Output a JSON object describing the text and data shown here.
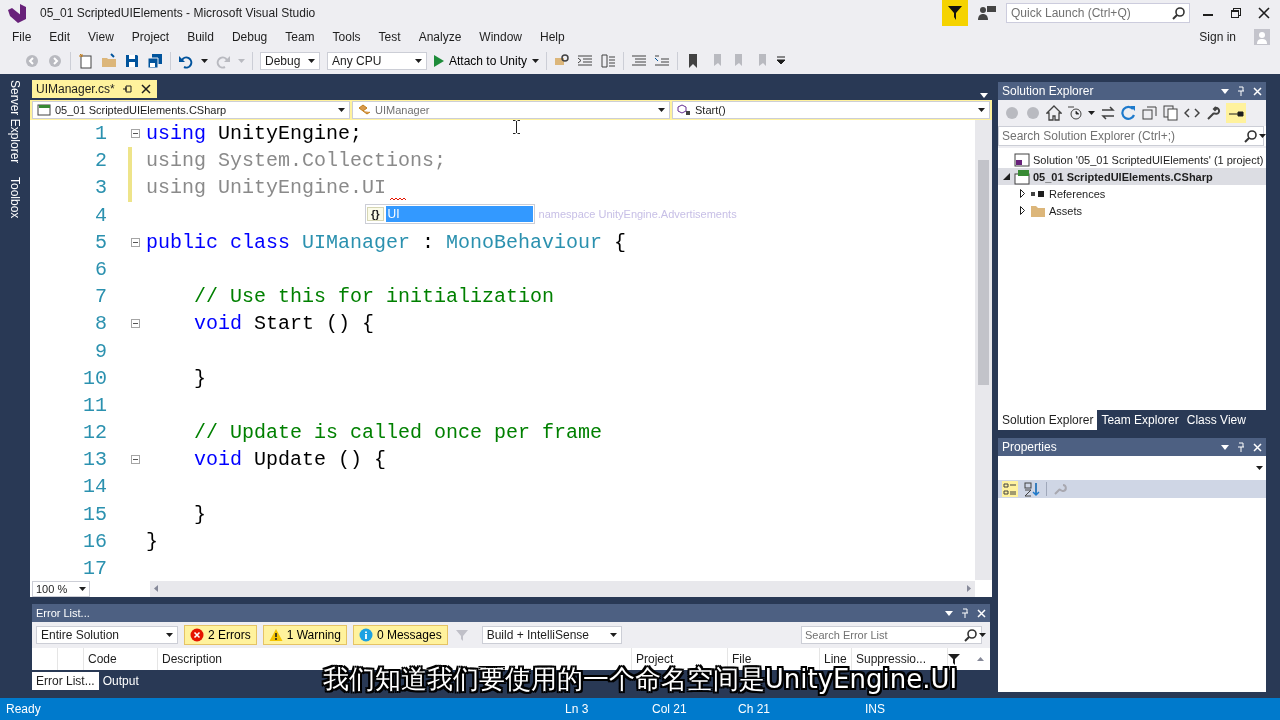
{
  "window": {
    "title": "05_01 ScriptedUIElements - Microsoft Visual Studio",
    "quick_launch_placeholder": "Quick Launch (Ctrl+Q)",
    "sign_in": "Sign in"
  },
  "menu": [
    "File",
    "Edit",
    "View",
    "Project",
    "Build",
    "Debug",
    "Team",
    "Tools",
    "Test",
    "Analyze",
    "Window",
    "Help"
  ],
  "toolbar": {
    "configuration": "Debug",
    "platform": "Any CPU",
    "run": "Attach to Unity"
  },
  "side_tabs": [
    "Server Explorer",
    "Toolbox"
  ],
  "document_tabs": [
    {
      "label": "UIManager.cs*",
      "selected": true
    }
  ],
  "navigation": {
    "project": "05_01 ScriptedUIElements.CSharp",
    "type": "UIManager",
    "member": "Start()"
  },
  "code_lines": [
    {
      "number": "1",
      "fold": true,
      "changed": false,
      "tokens": [
        {
          "kind": "keyword",
          "text": "using"
        },
        {
          "kind": "plain",
          "text": " UnityEngine;"
        }
      ]
    },
    {
      "number": "2",
      "fold": false,
      "changed": true,
      "tokens": [
        {
          "kind": "faded",
          "text": "using System.Collections;"
        }
      ]
    },
    {
      "number": "3",
      "fold": false,
      "changed": true,
      "tokens": [
        {
          "kind": "faded",
          "text": "using UnityEngine.UI"
        }
      ]
    },
    {
      "number": "4",
      "fold": false,
      "changed": false
    },
    {
      "number": "5",
      "fold": true,
      "changed": false,
      "tokens": [
        {
          "kind": "keyword",
          "text": "public class"
        },
        {
          "kind": "type",
          "text": " UIManager"
        },
        {
          "kind": "plain",
          "text": " : "
        },
        {
          "kind": "type",
          "text": "MonoBehaviour"
        },
        {
          "kind": "plain",
          "text": " {"
        }
      ]
    },
    {
      "number": "6",
      "fold": false,
      "changed": false
    },
    {
      "number": "7",
      "fold": false,
      "changed": false,
      "tokens": [
        {
          "kind": "comment",
          "text": "    // Use this for initialization"
        }
      ]
    },
    {
      "number": "8",
      "fold": true,
      "changed": false,
      "tokens": [
        {
          "kind": "keyword",
          "text": "    void"
        },
        {
          "kind": "plain",
          "text": " Start () {"
        }
      ]
    },
    {
      "number": "9",
      "fold": false,
      "changed": false
    },
    {
      "number": "10",
      "fold": false,
      "changed": false,
      "tokens": [
        {
          "kind": "plain",
          "text": "    }"
        }
      ]
    },
    {
      "number": "11",
      "fold": false,
      "changed": false
    },
    {
      "number": "12",
      "fold": false,
      "changed": false,
      "tokens": [
        {
          "kind": "comment",
          "text": "    // Update is called once per frame"
        }
      ]
    },
    {
      "number": "13",
      "fold": true,
      "changed": false,
      "tokens": [
        {
          "kind": "keyword",
          "text": "    void"
        },
        {
          "kind": "plain",
          "text": " Update () {"
        }
      ]
    },
    {
      "number": "14",
      "fold": false,
      "changed": false
    },
    {
      "number": "15",
      "fold": false,
      "changed": false,
      "tokens": [
        {
          "kind": "plain",
          "text": "    }"
        }
      ]
    },
    {
      "number": "16",
      "fold": false,
      "changed": false,
      "tokens": [
        {
          "kind": "plain",
          "text": "}"
        }
      ]
    },
    {
      "number": "17",
      "fold": false,
      "changed": false
    }
  ],
  "completion": {
    "items": [
      {
        "icon": "{}",
        "label": "UI",
        "selected": true
      }
    ],
    "tooltip": "namespace UnityEngine.Advertisements"
  },
  "zoom": "100 %",
  "error_list": {
    "title": "Error List...",
    "scope": "Entire Solution",
    "filters": [
      {
        "kind": "error",
        "label": "2 Errors",
        "on": true
      },
      {
        "kind": "warning",
        "label": "1 Warning",
        "on": true
      },
      {
        "kind": "message",
        "label": "0 Messages",
        "on": true
      }
    ],
    "source": "Build + IntelliSense",
    "search_placeholder": "Search Error List",
    "columns": [
      "Code",
      "Description",
      "Project",
      "File",
      "Line",
      "Suppressio..."
    ]
  },
  "bottom_tabs": [
    {
      "label": "Error List...",
      "selected": true
    },
    {
      "label": "Output",
      "selected": false
    }
  ],
  "solution_explorer": {
    "title": "Solution Explorer",
    "search_placeholder": "Search Solution Explorer (Ctrl+;)",
    "tree": [
      {
        "label": "Solution '05_01 ScriptedUIElements' (1 project)",
        "kind": "solution",
        "selected": false,
        "children": [
          {
            "label": "05_01 ScriptedUIElements.CSharp",
            "kind": "project",
            "expanded": true,
            "selected": true,
            "children": [
              {
                "label": "References",
                "kind": "references",
                "expanded": false,
                "selected": false
              },
              {
                "label": "Assets",
                "kind": "folder",
                "expanded": false,
                "selected": false
              }
            ]
          }
        ]
      }
    ]
  },
  "panel_tabs": [
    {
      "label": "Solution Explorer",
      "selected": true
    },
    {
      "label": "Team Explorer",
      "selected": false
    },
    {
      "label": "Class View",
      "selected": false
    }
  ],
  "properties": {
    "title": "Properties"
  },
  "status_bar": {
    "message": "Ready",
    "line": "Ln 3",
    "column": "Col 21",
    "char": "Ch 21",
    "mode": "INS"
  },
  "subtitle": "我们知道我们要使用的一个命名空间是UnityEngine.UI"
}
